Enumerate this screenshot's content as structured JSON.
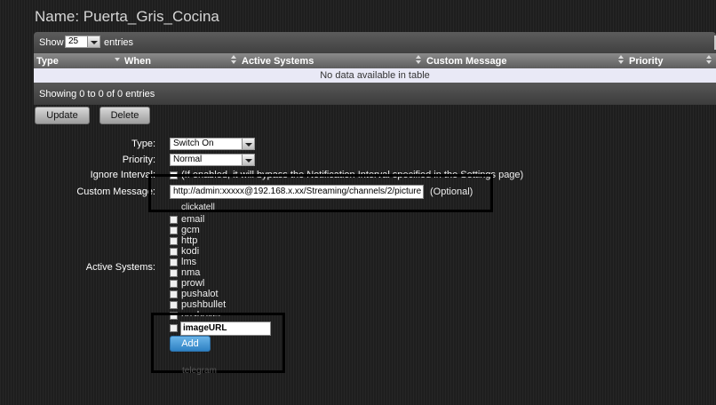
{
  "header": {
    "title": "Name: Puerta_Gris_Cocina"
  },
  "table": {
    "show_label": "Show",
    "page_size": "25",
    "entries_label": "entries",
    "columns": [
      "Type",
      "When",
      "Active Systems",
      "Custom Message",
      "Priority"
    ],
    "empty_message": "No data available in table",
    "info": "Showing 0 to 0 of 0 entries"
  },
  "actions": {
    "update_label": "Update",
    "delete_label": "Delete"
  },
  "form": {
    "type_label": "Type:",
    "type_value": "Switch On",
    "priority_label": "Priority:",
    "priority_value": "Normal",
    "ignore_interval_label": "Ignore Interval:",
    "ignore_interval_help": "(If enabled, it will bypass the Notification Interval specified in the Settings page)",
    "custom_message_label": "Custom Message:",
    "custom_message_value": "http://admin:xxxxx@192.168.x.xx/Streaming/channels/2/picture",
    "custom_message_hint": "(Optional)",
    "active_systems_label": "Active Systems:",
    "clickatell_label": "clickatell",
    "systems": [
      "email",
      "gcm",
      "http",
      "kodi",
      "lms",
      "nma",
      "prowl",
      "pushalot",
      "pushbullet",
      "pushover"
    ],
    "image_url_value": "imageURL",
    "add_label": "Add",
    "faded_label": "telegram"
  },
  "colors": {
    "accent": "#3a8fd0",
    "callout": "#000000",
    "empty_row": "#e9e9f6"
  }
}
